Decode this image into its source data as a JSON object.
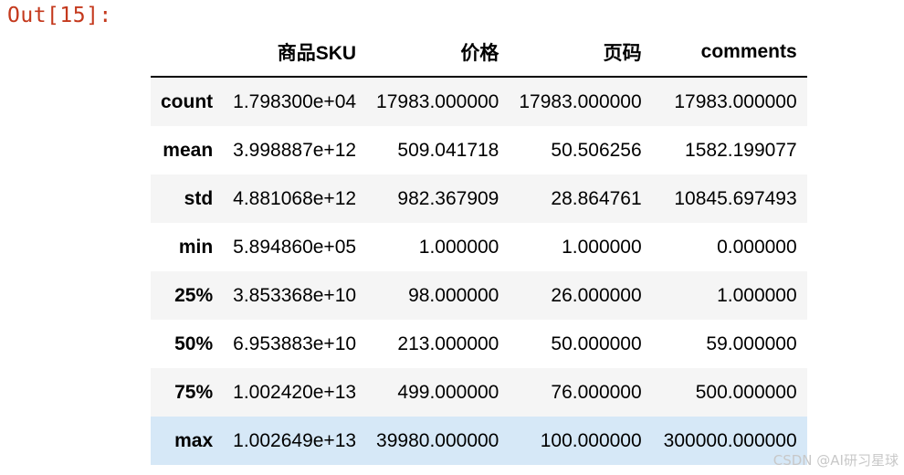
{
  "prompt": "Out[15]:",
  "table": {
    "columns": [
      "",
      "商品SKU",
      "价格",
      "页码",
      "comments"
    ],
    "rows": [
      {
        "index": "count",
        "values": [
          "1.798300e+04",
          "17983.000000",
          "17983.000000",
          "17983.000000"
        ]
      },
      {
        "index": "mean",
        "values": [
          "3.998887e+12",
          "509.041718",
          "50.506256",
          "1582.199077"
        ]
      },
      {
        "index": "std",
        "values": [
          "4.881068e+12",
          "982.367909",
          "28.864761",
          "10845.697493"
        ]
      },
      {
        "index": "min",
        "values": [
          "5.894860e+05",
          "1.000000",
          "1.000000",
          "0.000000"
        ]
      },
      {
        "index": "25%",
        "values": [
          "3.853368e+10",
          "98.000000",
          "26.000000",
          "1.000000"
        ]
      },
      {
        "index": "50%",
        "values": [
          "6.953883e+10",
          "213.000000",
          "50.000000",
          "59.000000"
        ]
      },
      {
        "index": "75%",
        "values": [
          "1.002420e+13",
          "499.000000",
          "76.000000",
          "500.000000"
        ]
      },
      {
        "index": "max",
        "values": [
          "1.002649e+13",
          "39980.000000",
          "100.000000",
          "300000.000000"
        ]
      }
    ]
  },
  "watermark": "CSDN @AI研习星球",
  "colors": {
    "prompt": "#c4391d",
    "row_stripe": "#f5f5f5",
    "row_hover": "#d6e8f7"
  }
}
